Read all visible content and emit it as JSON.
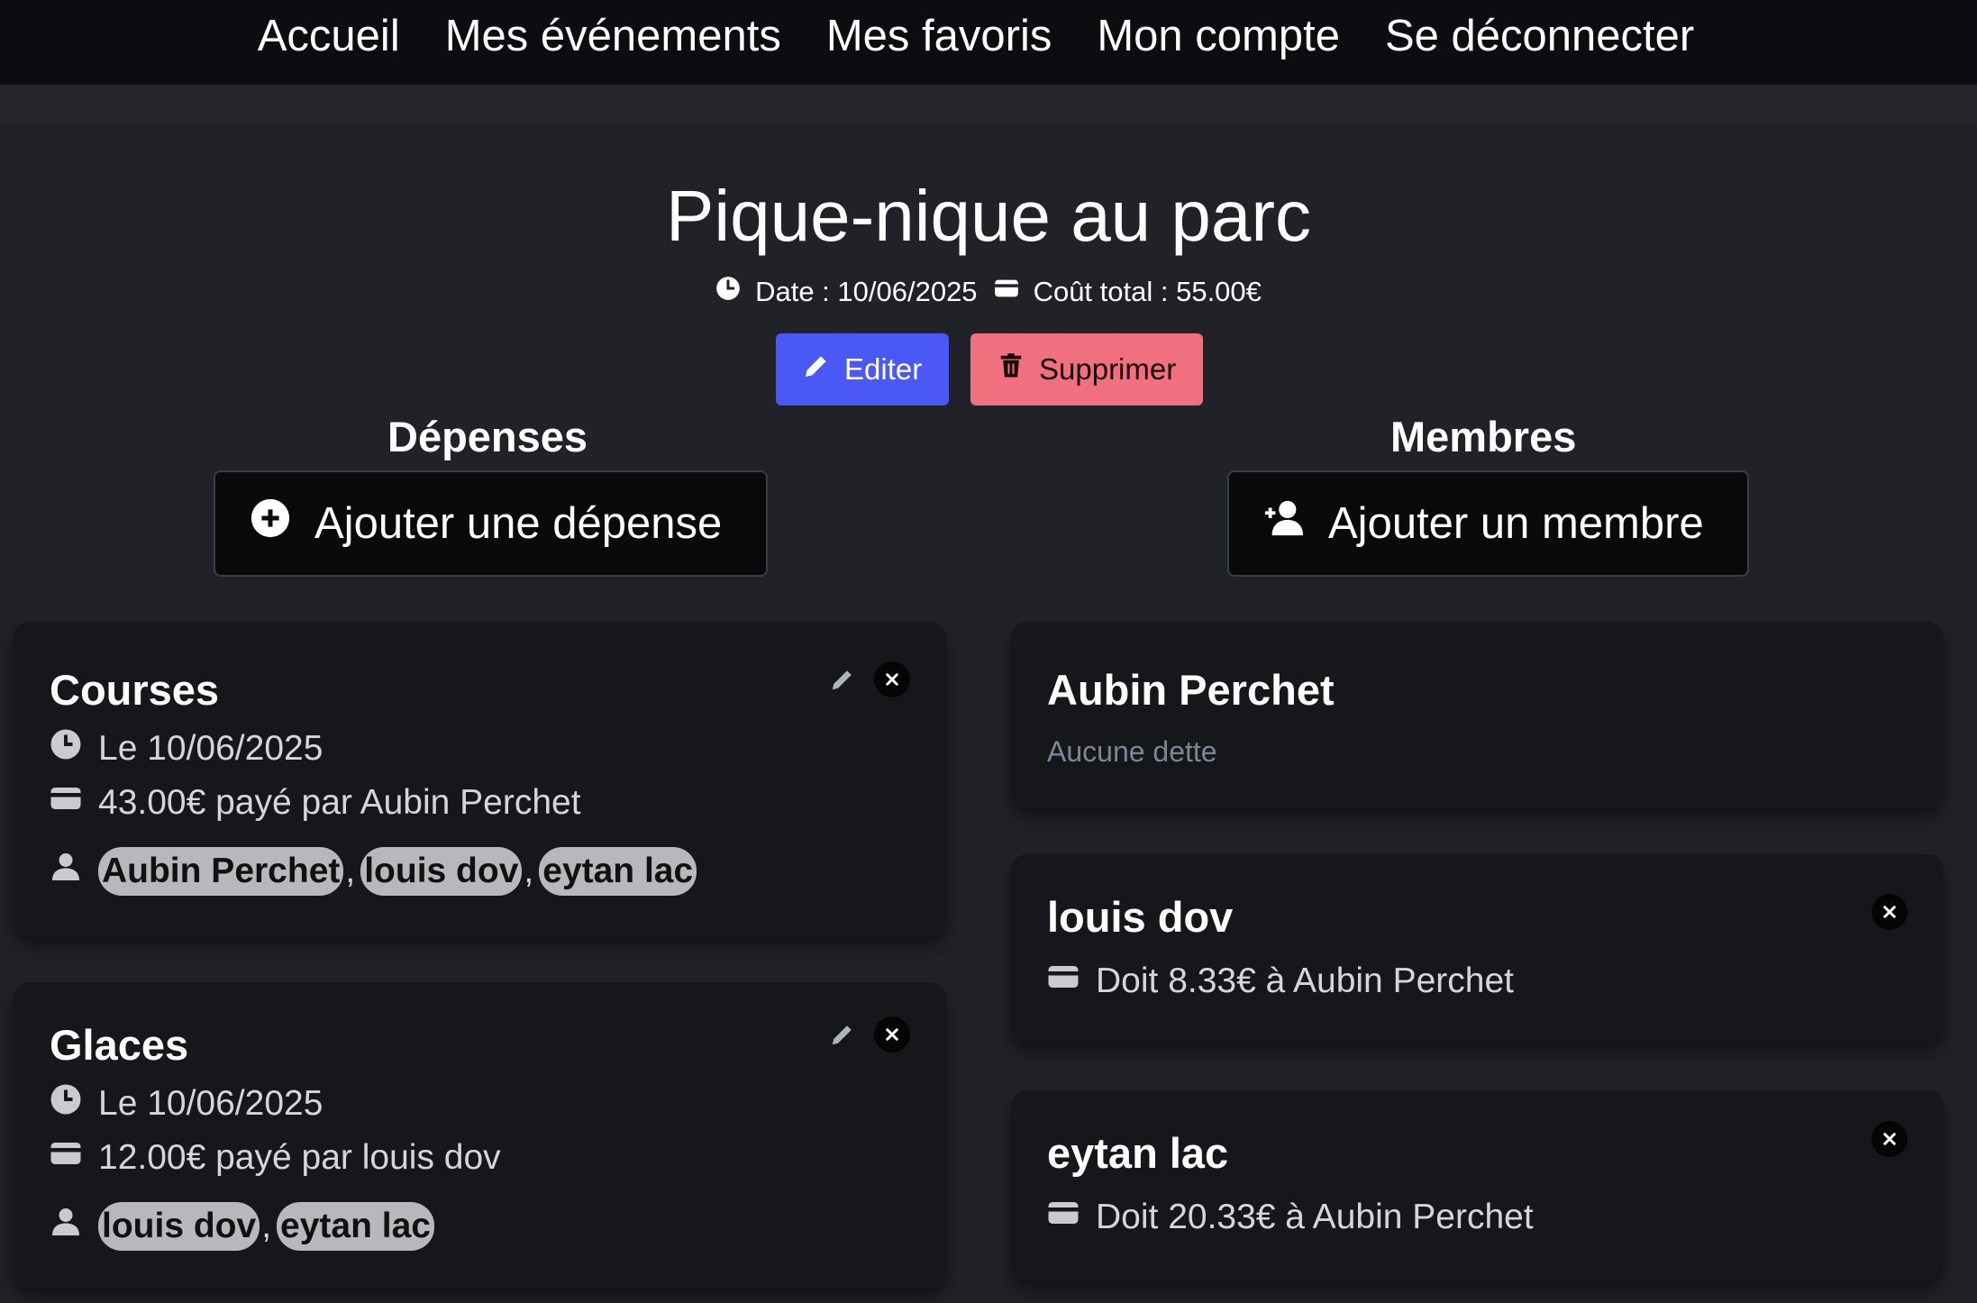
{
  "nav": {
    "items": [
      "Accueil",
      "Mes événements",
      "Mes favoris",
      "Mon compte",
      "Se déconnecter"
    ]
  },
  "event": {
    "title": "Pique-nique au parc",
    "date": "Date : 10/06/2025",
    "total": "Coût total : 55.00€",
    "edit_label": "Editer",
    "delete_label": "Supprimer"
  },
  "expenses": {
    "heading": "Dépenses",
    "add_label": "Ajouter une dépense",
    "items": [
      {
        "title": "Courses",
        "date": "Le 10/06/2025",
        "paid": "43.00€ payé par Aubin Perchet",
        "participants": [
          "Aubin Perchet",
          "louis dov",
          "eytan lac"
        ]
      },
      {
        "title": "Glaces",
        "date": "Le 10/06/2025",
        "paid": "12.00€ payé par louis dov",
        "participants": [
          "louis dov",
          "eytan lac"
        ]
      }
    ]
  },
  "members": {
    "heading": "Membres",
    "add_label": "Ajouter un membre",
    "items": [
      {
        "name": "Aubin Perchet",
        "status": "Aucune dette"
      },
      {
        "name": "louis dov",
        "debt": "Doit 8.33€ à Aubin Perchet"
      },
      {
        "name": "eytan lac",
        "debt": "Doit 20.33€ à Aubin Perchet"
      }
    ]
  },
  "colors": {
    "edit_button": "#4a58f5",
    "delete_button": "#f07080",
    "background": "#212227",
    "card": "#16171b"
  }
}
